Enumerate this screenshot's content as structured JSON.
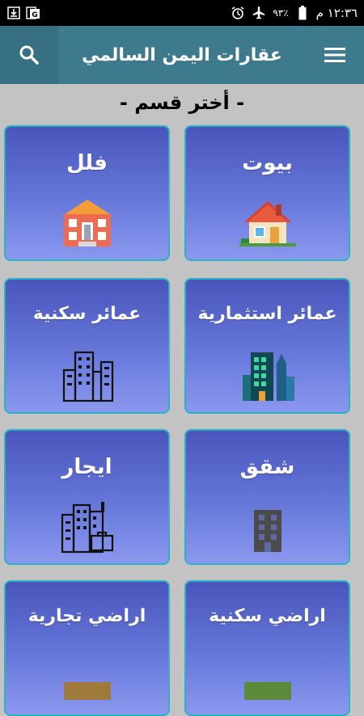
{
  "status_bar": {
    "time": "١٢:٣٦ م",
    "battery": "٩٣٪"
  },
  "app_bar": {
    "title": "عقارات اليمن السالمي"
  },
  "section_title": "- أختر قسم -",
  "categories": [
    {
      "label": "بيوت",
      "icon": "house-icon"
    },
    {
      "label": "فلل",
      "icon": "villa-icon"
    },
    {
      "label": "عمائر استثمارية",
      "icon": "investment-buildings-icon"
    },
    {
      "label": "عمائر سكنية",
      "icon": "residential-buildings-icon"
    },
    {
      "label": "شقق",
      "icon": "apartment-building-icon"
    },
    {
      "label": "ايجار",
      "icon": "rent-buildings-icon"
    },
    {
      "label": "اراضي سكنية",
      "icon": "residential-land-icon"
    },
    {
      "label": "اراضي تجارية",
      "icon": "commercial-land-icon"
    }
  ],
  "colors": {
    "app_bar": "#3e7a8e",
    "card_top": "#4a55bb",
    "card_bottom": "#8b98ef",
    "card_border": "#29b3c6",
    "background": "#c3c3c3"
  }
}
